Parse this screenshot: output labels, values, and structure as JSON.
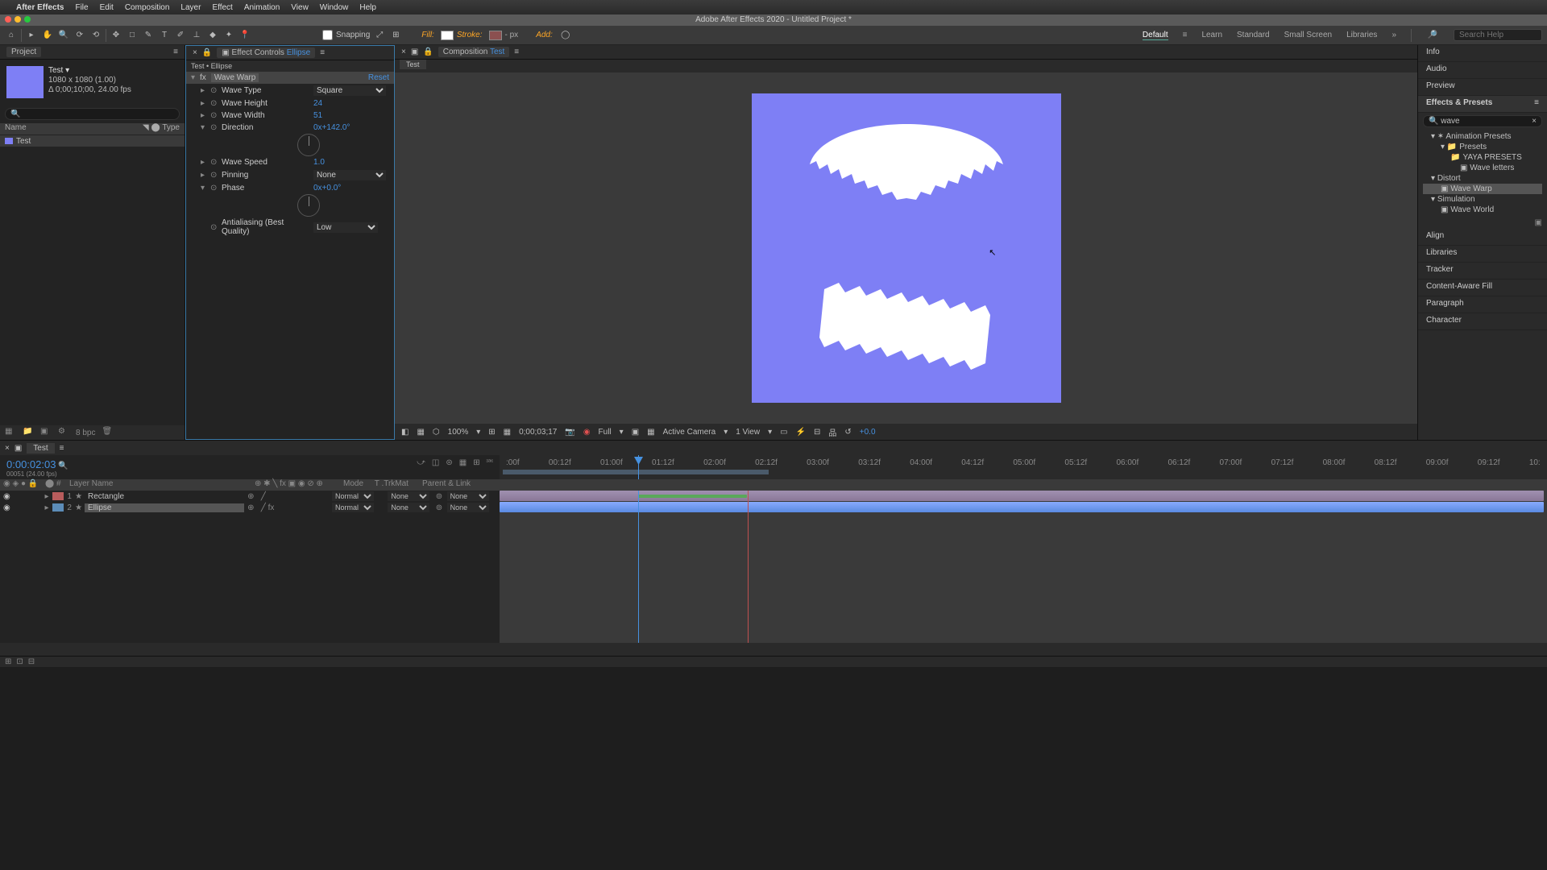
{
  "menubar": {
    "app": "After Effects",
    "items": [
      "File",
      "Edit",
      "Composition",
      "Layer",
      "Effect",
      "Animation",
      "View",
      "Window",
      "Help"
    ]
  },
  "titlebar": "Adobe After Effects 2020 - Untitled Project *",
  "toolbar": {
    "snapping": "Snapping",
    "fill": "Fill:",
    "stroke": "Stroke:",
    "strokepx": "- px",
    "add": "Add:",
    "workspaces": [
      "Default",
      "Learn",
      "Standard",
      "Small Screen",
      "Libraries"
    ],
    "search_ph": "Search Help"
  },
  "project": {
    "title": "Project",
    "comp_name": "Test ▾",
    "dims": "1080 x 1080 (1.00)",
    "dur": "Δ 0;00;10;00, 24.00 fps",
    "headers": {
      "name": "Name",
      "type": "Type"
    },
    "items": [
      {
        "name": "Test"
      }
    ],
    "bpc": "8 bpc"
  },
  "fx": {
    "title": "Effect Controls",
    "layer": "Ellipse",
    "crumb": "Test • Ellipse",
    "name": "Wave Warp",
    "reset": "Reset",
    "props": {
      "wave_type": {
        "n": "Wave Type",
        "v": "Square"
      },
      "wave_height": {
        "n": "Wave Height",
        "v": "24"
      },
      "wave_width": {
        "n": "Wave Width",
        "v": "51"
      },
      "direction": {
        "n": "Direction",
        "v": "0x+142.0°"
      },
      "wave_speed": {
        "n": "Wave Speed",
        "v": "1.0"
      },
      "pinning": {
        "n": "Pinning",
        "v": "None"
      },
      "phase": {
        "n": "Phase",
        "v": "0x+0.0°"
      },
      "aa": {
        "n": "Antialiasing (Best Quality)",
        "v": "Low"
      }
    }
  },
  "composition": {
    "title": "Composition",
    "name": "Test",
    "tab": "Test",
    "footer": {
      "zoom": "100%",
      "tc": "0;00;03;17",
      "res": "Full",
      "cam": "Active Camera",
      "view": "1 View",
      "exp": "+0.0"
    }
  },
  "right": {
    "items": [
      "Info",
      "Audio",
      "Preview"
    ],
    "ep_title": "Effects & Presets",
    "ep_search": "wave",
    "tree": {
      "anim": "Animation Presets",
      "presets": "Presets",
      "yaya": "YAYA PRESETS",
      "wl": "Wave letters",
      "distort": "Distort",
      "ww": "Wave Warp",
      "sim": "Simulation",
      "wworld": "Wave World"
    },
    "panels": [
      "Align",
      "Libraries",
      "Tracker",
      "Content-Aware Fill",
      "Paragraph",
      "Character"
    ]
  },
  "timeline": {
    "tab": "Test",
    "tc": "0:00:02:03",
    "tc_sub": "00051 (24.00 fps)",
    "ticks": [
      ":00f",
      "00:12f",
      "01:00f",
      "01:12f",
      "02:00f",
      "02:12f",
      "03:00f",
      "03:12f",
      "04:00f",
      "04:12f",
      "05:00f",
      "05:12f",
      "06:00f",
      "06:12f",
      "07:00f",
      "07:12f",
      "08:00f",
      "08:12f",
      "09:00f",
      "09:12f",
      "10:"
    ],
    "cols": {
      "ln": "Layer Name",
      "mode": "Mode",
      "trk": "T .TrkMat",
      "par": "Parent & Link"
    },
    "layers": [
      {
        "num": "1",
        "name": "Rectangle",
        "mode": "Normal",
        "trk": "None",
        "par": "None",
        "color": "r"
      },
      {
        "num": "2",
        "name": "Ellipse",
        "mode": "Normal",
        "trk": "None",
        "par": "None",
        "color": "b",
        "sel": true
      }
    ]
  }
}
